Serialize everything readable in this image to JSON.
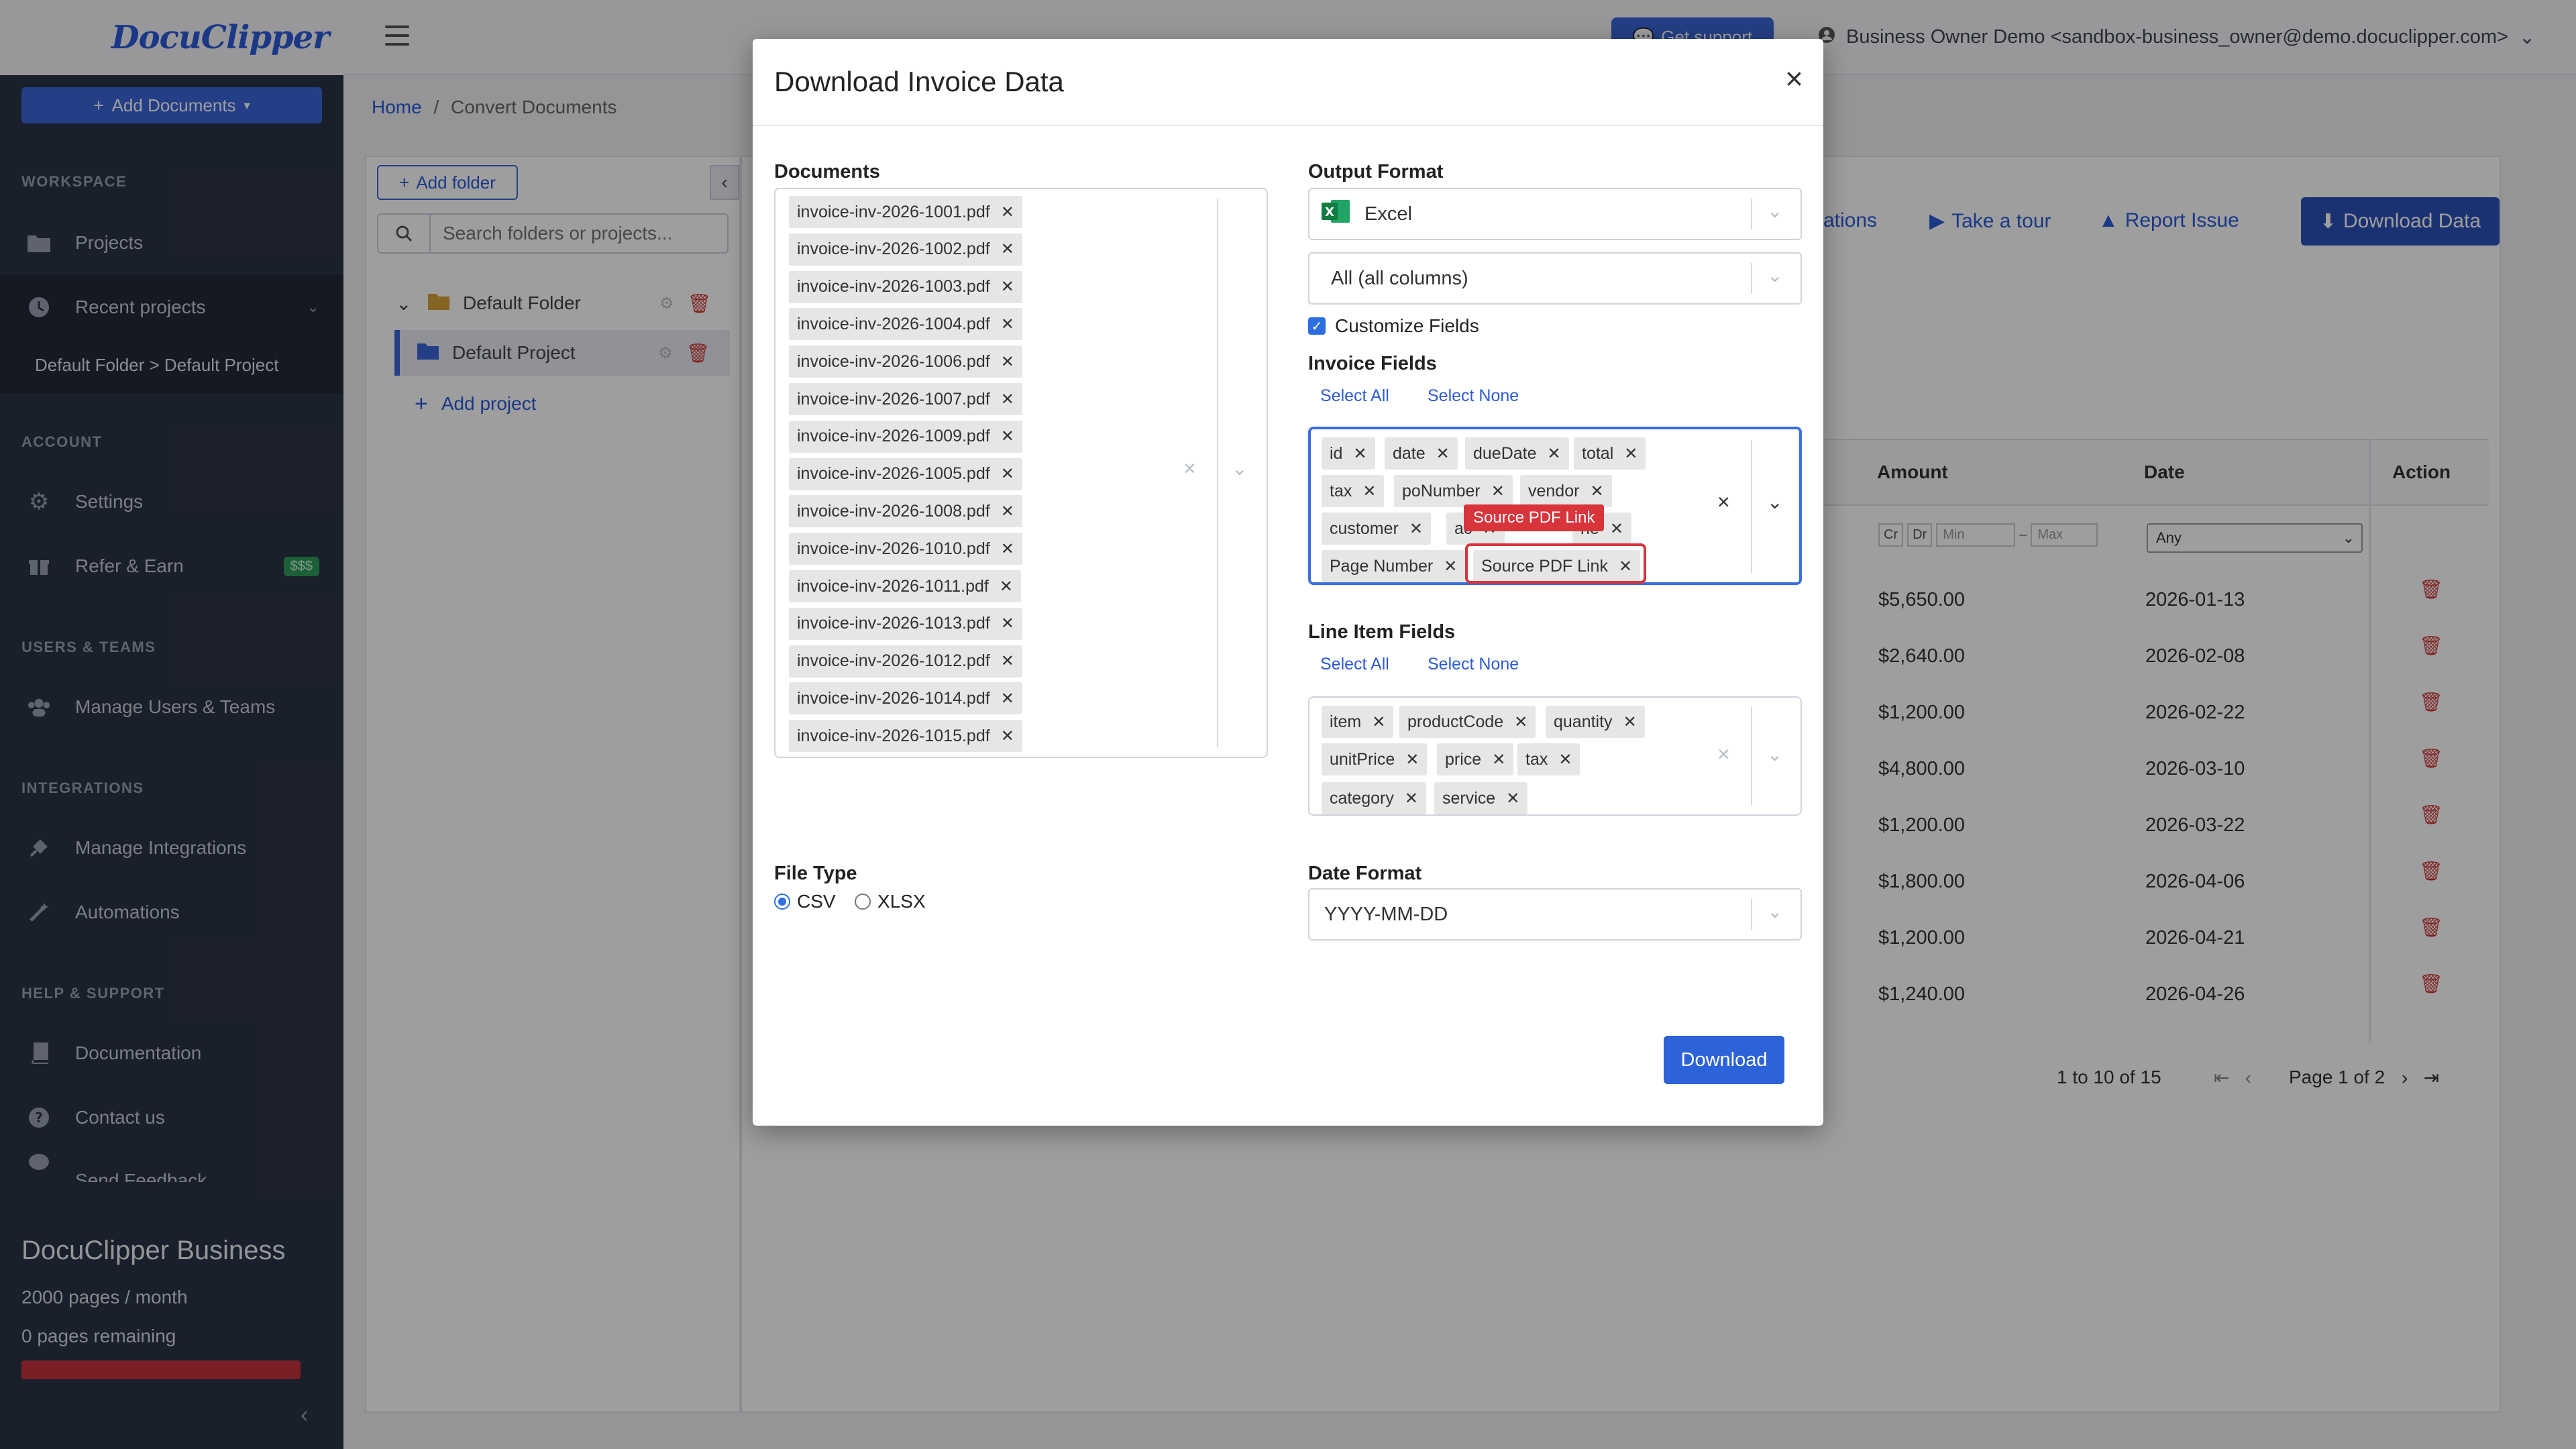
{
  "sidebar": {
    "logo": "DocuClipper",
    "add_documents": "Add Documents",
    "sections": {
      "workspace": "WORKSPACE",
      "account": "ACCOUNT",
      "users_teams": "USERS & TEAMS",
      "integrations": "INTEGRATIONS",
      "help": "HELP & SUPPORT"
    },
    "items": {
      "projects": "Projects",
      "recent": "Recent projects",
      "recent_sub": "Default Folder > Default Project",
      "settings": "Settings",
      "refer": "Refer & Earn",
      "refer_badge": "$$$",
      "manage_users": "Manage Users & Teams",
      "manage_integrations": "Manage Integrations",
      "automations": "Automations",
      "documentation": "Documentation",
      "contact": "Contact us",
      "feedback": "Send Feedback"
    },
    "plan": {
      "name": "DocuClipper Business",
      "pages_month": "2000 pages / month",
      "remaining": "0 pages remaining"
    }
  },
  "topbar": {
    "support": "Get support",
    "user": "Business Owner Demo <sandbox-business_owner@demo.docuclipper.com>"
  },
  "breadcrumb": {
    "home": "Home",
    "sep": "/",
    "current": "Convert Documents"
  },
  "folders": {
    "add_folder": "Add folder",
    "search_placeholder": "Search folders or projects...",
    "default_folder": "Default Folder",
    "default_project": "Default Project",
    "add_project": "Add project"
  },
  "main": {
    "toolbar": {
      "integrations": "ations",
      "tour": "Take a tour",
      "report": "Report Issue",
      "download": "Download Data"
    },
    "table": {
      "headers": {
        "amount": "Amount",
        "date": "Date",
        "action": "Action"
      },
      "filter": {
        "cr": "Cr",
        "dr": "Dr",
        "min": "Min",
        "dash": "–",
        "max": "Max",
        "any": "Any"
      },
      "rows": [
        {
          "amount": "$5,650.00",
          "date": "2026-01-13"
        },
        {
          "amount": "$2,640.00",
          "date": "2026-02-08"
        },
        {
          "amount": "$1,200.00",
          "date": "2026-02-22"
        },
        {
          "amount": "$4,800.00",
          "date": "2026-03-10"
        },
        {
          "amount": "$1,200.00",
          "date": "2026-03-22"
        },
        {
          "amount": "$1,800.00",
          "date": "2026-04-06"
        },
        {
          "amount": "$1,200.00",
          "date": "2026-04-21"
        },
        {
          "amount": "$1,240.00",
          "date": "2026-04-26"
        }
      ],
      "pager": {
        "range": "1 to 10 of 15",
        "page": "Page 1 of 2"
      }
    }
  },
  "modal": {
    "title": "Download Invoice Data",
    "documents_label": "Documents",
    "documents": [
      "invoice-inv-2026-1001.pdf",
      "invoice-inv-2026-1002.pdf",
      "invoice-inv-2026-1003.pdf",
      "invoice-inv-2026-1004.pdf",
      "invoice-inv-2026-1006.pdf",
      "invoice-inv-2026-1007.pdf",
      "invoice-inv-2026-1009.pdf",
      "invoice-inv-2026-1005.pdf",
      "invoice-inv-2026-1008.pdf",
      "invoice-inv-2026-1010.pdf",
      "invoice-inv-2026-1011.pdf",
      "invoice-inv-2026-1013.pdf",
      "invoice-inv-2026-1012.pdf",
      "invoice-inv-2026-1014.pdf",
      "invoice-inv-2026-1015.pdf"
    ],
    "output_format_label": "Output Format",
    "output_format": "Excel",
    "columns": "All (all columns)",
    "customize_fields": "Customize Fields",
    "invoice_fields_label": "Invoice Fields",
    "select_all": "Select All",
    "select_none": "Select None",
    "invoice_fields": [
      "id",
      "date",
      "dueDate",
      "total",
      "tax",
      "poNumber",
      "vendor",
      "customer",
      "ac",
      "ne",
      "Page Number",
      "Source PDF Link"
    ],
    "tooltip": "Source PDF Link",
    "line_item_label": "Line Item Fields",
    "line_item_fields": [
      "item",
      "productCode",
      "quantity",
      "unitPrice",
      "price",
      "tax",
      "category",
      "service"
    ],
    "file_type_label": "File Type",
    "file_types": [
      "CSV",
      "XLSX"
    ],
    "date_format_label": "Date Format",
    "date_format": "YYYY-MM-DD",
    "download": "Download"
  }
}
